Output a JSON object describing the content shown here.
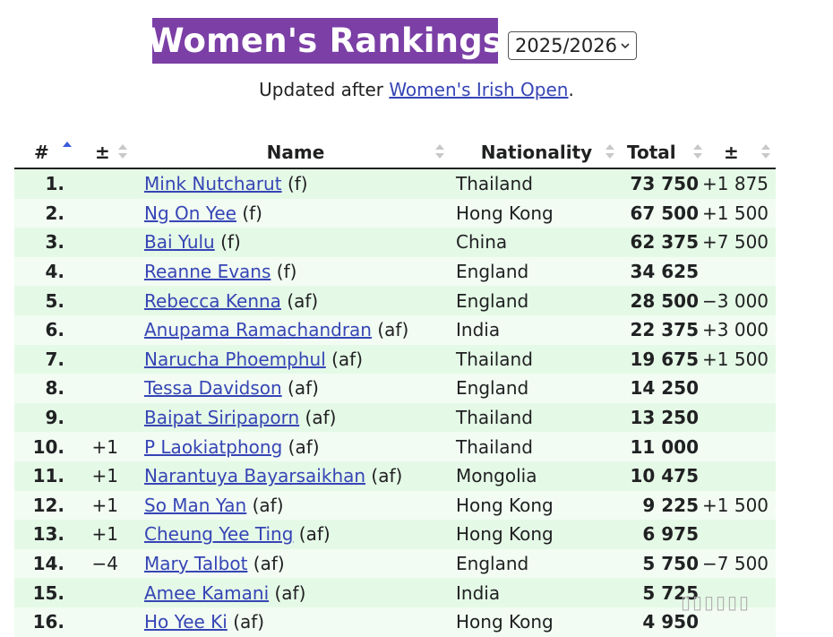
{
  "title": "Women's Rankings",
  "season_select": {
    "value": "2025/2026"
  },
  "updated": {
    "prefix": "Updated after ",
    "link": "Women's Irish Open",
    "suffix": "."
  },
  "columns": [
    "#",
    "±",
    "Name",
    "Nationality",
    "Total",
    "±"
  ],
  "rows": [
    {
      "rank": "1.",
      "chg": "",
      "name": "Mink Nutcharut",
      "tag": "(f)",
      "nat": "Thailand",
      "total": "73 750",
      "diff": "+1 875"
    },
    {
      "rank": "2.",
      "chg": "",
      "name": "Ng On Yee",
      "tag": "(f)",
      "nat": "Hong Kong",
      "total": "67 500",
      "diff": "+1 500"
    },
    {
      "rank": "3.",
      "chg": "",
      "name": "Bai Yulu",
      "tag": "(f)",
      "nat": "China",
      "total": "62 375",
      "diff": "+7 500"
    },
    {
      "rank": "4.",
      "chg": "",
      "name": "Reanne Evans",
      "tag": "(f)",
      "nat": "England",
      "total": "34 625",
      "diff": ""
    },
    {
      "rank": "5.",
      "chg": "",
      "name": "Rebecca Kenna",
      "tag": "(af)",
      "nat": "England",
      "total": "28 500",
      "diff": "−3 000"
    },
    {
      "rank": "6.",
      "chg": "",
      "name": "Anupama Ramachandran",
      "tag": "(af)",
      "nat": "India",
      "total": "22 375",
      "diff": "+3 000"
    },
    {
      "rank": "7.",
      "chg": "",
      "name": "Narucha Phoemphul",
      "tag": "(af)",
      "nat": "Thailand",
      "total": "19 675",
      "diff": "+1 500"
    },
    {
      "rank": "8.",
      "chg": "",
      "name": "Tessa Davidson",
      "tag": "(af)",
      "nat": "England",
      "total": "14 250",
      "diff": ""
    },
    {
      "rank": "9.",
      "chg": "",
      "name": "Baipat Siripaporn",
      "tag": "(af)",
      "nat": "Thailand",
      "total": "13 250",
      "diff": ""
    },
    {
      "rank": "10.",
      "chg": "+1",
      "name": "P Laokiatphong",
      "tag": "(af)",
      "nat": "Thailand",
      "total": "11 000",
      "diff": ""
    },
    {
      "rank": "11.",
      "chg": "+1",
      "name": "Narantuya Bayarsaikhan",
      "tag": "(af)",
      "nat": "Mongolia",
      "total": "10 475",
      "diff": ""
    },
    {
      "rank": "12.",
      "chg": "+1",
      "name": "So Man Yan",
      "tag": "(af)",
      "nat": "Hong Kong",
      "total": "9 225",
      "diff": "+1 500"
    },
    {
      "rank": "13.",
      "chg": "+1",
      "name": "Cheung Yee Ting",
      "tag": "(af)",
      "nat": "Hong Kong",
      "total": "6 975",
      "diff": ""
    },
    {
      "rank": "14.",
      "chg": "−4",
      "name": "Mary Talbot",
      "tag": "(af)",
      "nat": "England",
      "total": "5 750",
      "diff": "−7 500"
    },
    {
      "rank": "15.",
      "chg": "",
      "name": "Amee Kamani",
      "tag": "(af)",
      "nat": "India",
      "total": "5 725",
      "diff": ""
    },
    {
      "rank": "16.",
      "chg": "",
      "name": "Ho Yee Ki",
      "tag": "(af)",
      "nat": "Hong Kong",
      "total": "4 950",
      "diff": ""
    }
  ],
  "colors": {
    "title_bg": "#7b3fa6",
    "row_odd": "#e5f9e7",
    "row_even": "#f2fcf3",
    "link": "#3645b5",
    "sort_active": "#3b5bdb"
  },
  "icons": {
    "sort": "sort-arrows-icon",
    "sort_active": "sort-ascending-icon",
    "select": "chevron-down-icon"
  }
}
